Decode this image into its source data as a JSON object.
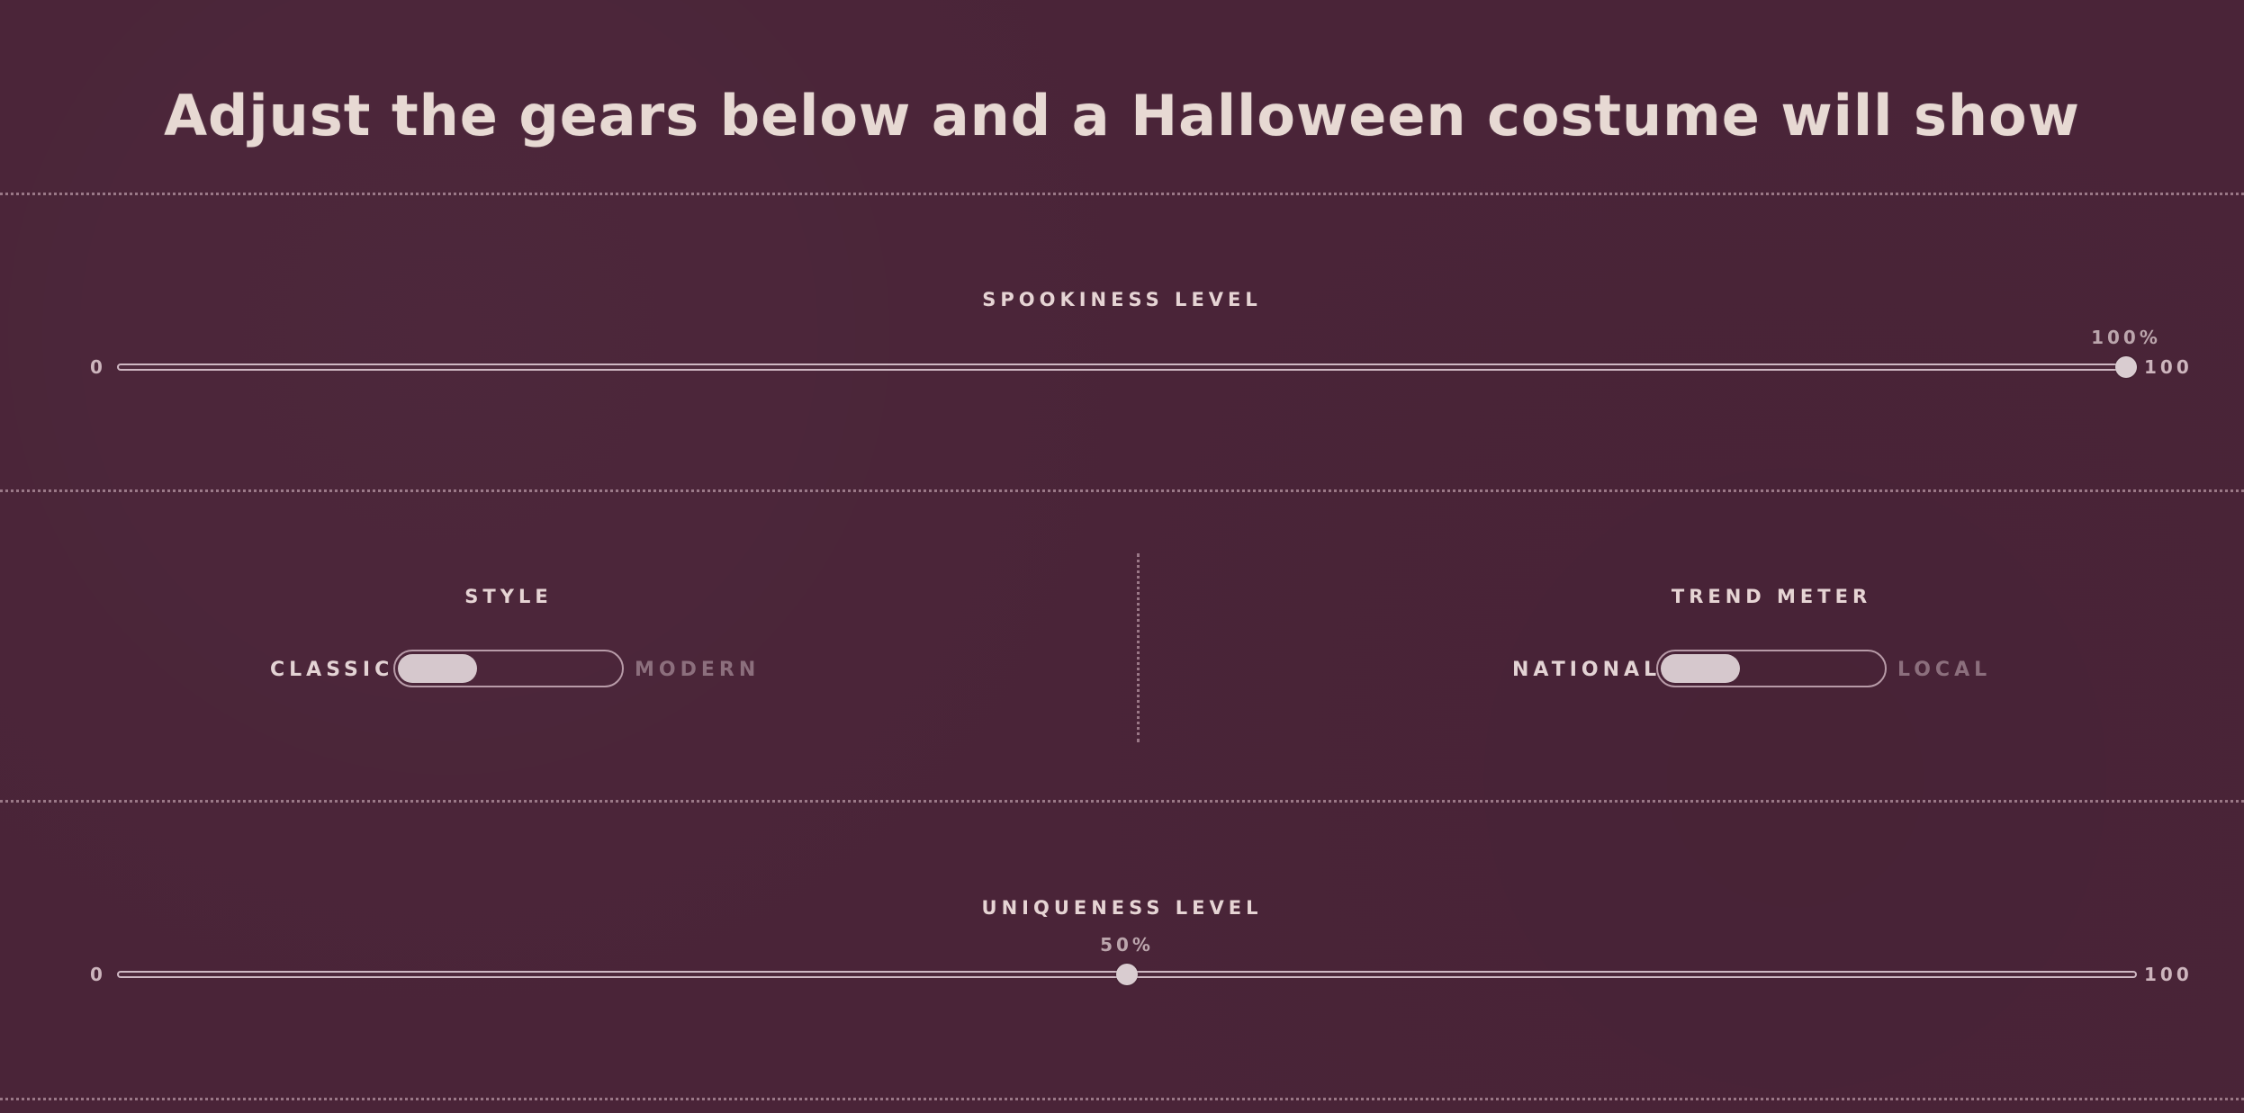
{
  "title": "Adjust the gears below and a Halloween costume will show",
  "spookiness": {
    "label": "SPOOKINESS LEVEL",
    "min_label": "0",
    "max_label": "100",
    "value": 100,
    "value_label": "100%"
  },
  "style": {
    "label": "STYLE",
    "left_option": "CLASSIC",
    "right_option": "MODERN",
    "selected": "CLASSIC"
  },
  "trend": {
    "label": "TREND METER",
    "left_option": "NATIONAL",
    "right_option": "LOCAL",
    "selected": "NATIONAL"
  },
  "uniqueness": {
    "label": "UNIQUENESS LEVEL",
    "min_label": "0",
    "max_label": "100",
    "value": 50,
    "value_label": "50%"
  },
  "colors": {
    "background": "#4a2438",
    "text": "#e8dad6",
    "muted_text": "#8c6f7d",
    "thumb": "#d9ccd0"
  }
}
